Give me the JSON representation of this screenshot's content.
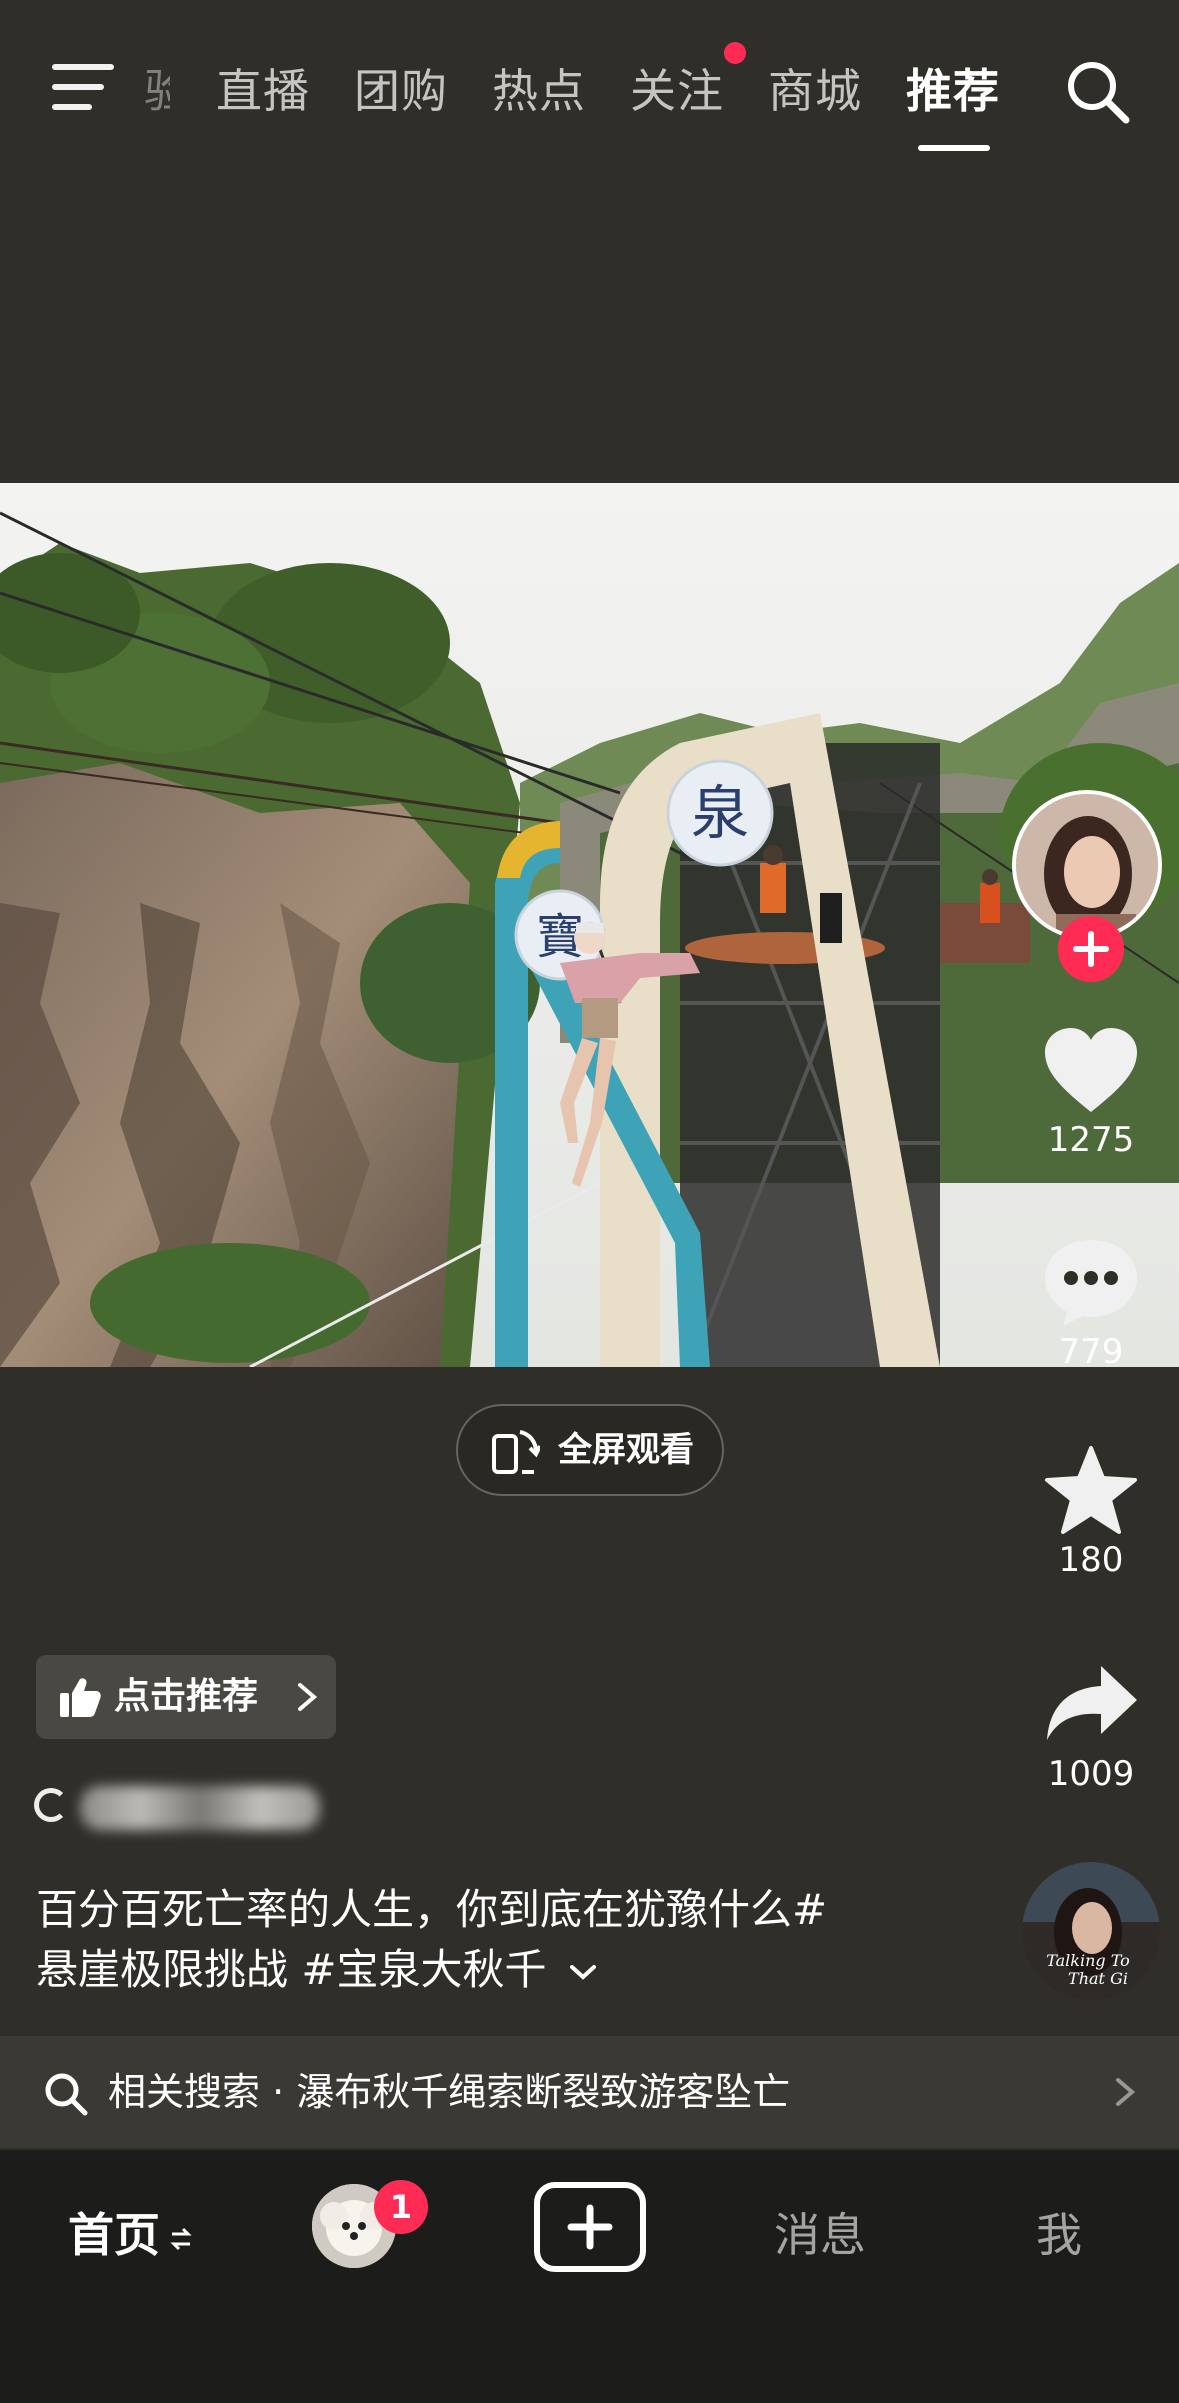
{
  "top_nav": {
    "tabs": [
      {
        "label": "验",
        "active": false
      },
      {
        "label": "直播",
        "active": false
      },
      {
        "label": "团购",
        "active": false
      },
      {
        "label": "热点",
        "active": false
      },
      {
        "label": "关注",
        "active": false,
        "has_notification_dot": true
      },
      {
        "label": "商城",
        "active": false
      },
      {
        "label": "推荐",
        "active": true
      }
    ],
    "icons": [
      "menu-icon",
      "search-icon"
    ]
  },
  "video": {
    "scene": "cliff swing with 寶泉 signage",
    "sign_characters": [
      "泉",
      "寶"
    ]
  },
  "fullscreen_button": {
    "label": "全屏观看"
  },
  "actions": {
    "like_count": "1275",
    "comment_count": "779",
    "favorite_count": "180",
    "share_count": "1009"
  },
  "recommend_button": {
    "label": "点击推荐"
  },
  "caption": {
    "line1": "百分百死亡率的人生，你到底在犹豫什么#",
    "line2": "悬崖极限挑战 #宝泉大秋千"
  },
  "music_disc": {
    "text_line1": "Talking To",
    "text_line2": "That Gi"
  },
  "related_search": {
    "label": "相关搜索 · 瀑布秋千绳索断裂致游客坠亡"
  },
  "bottom_nav": {
    "home_label": "首页",
    "messages_label": "消息",
    "me_label": "我",
    "friend_badge": "1"
  },
  "colors": {
    "background": "#302e28",
    "accent": "#fe2c55",
    "bottom_bar": "#1c1c1a"
  }
}
